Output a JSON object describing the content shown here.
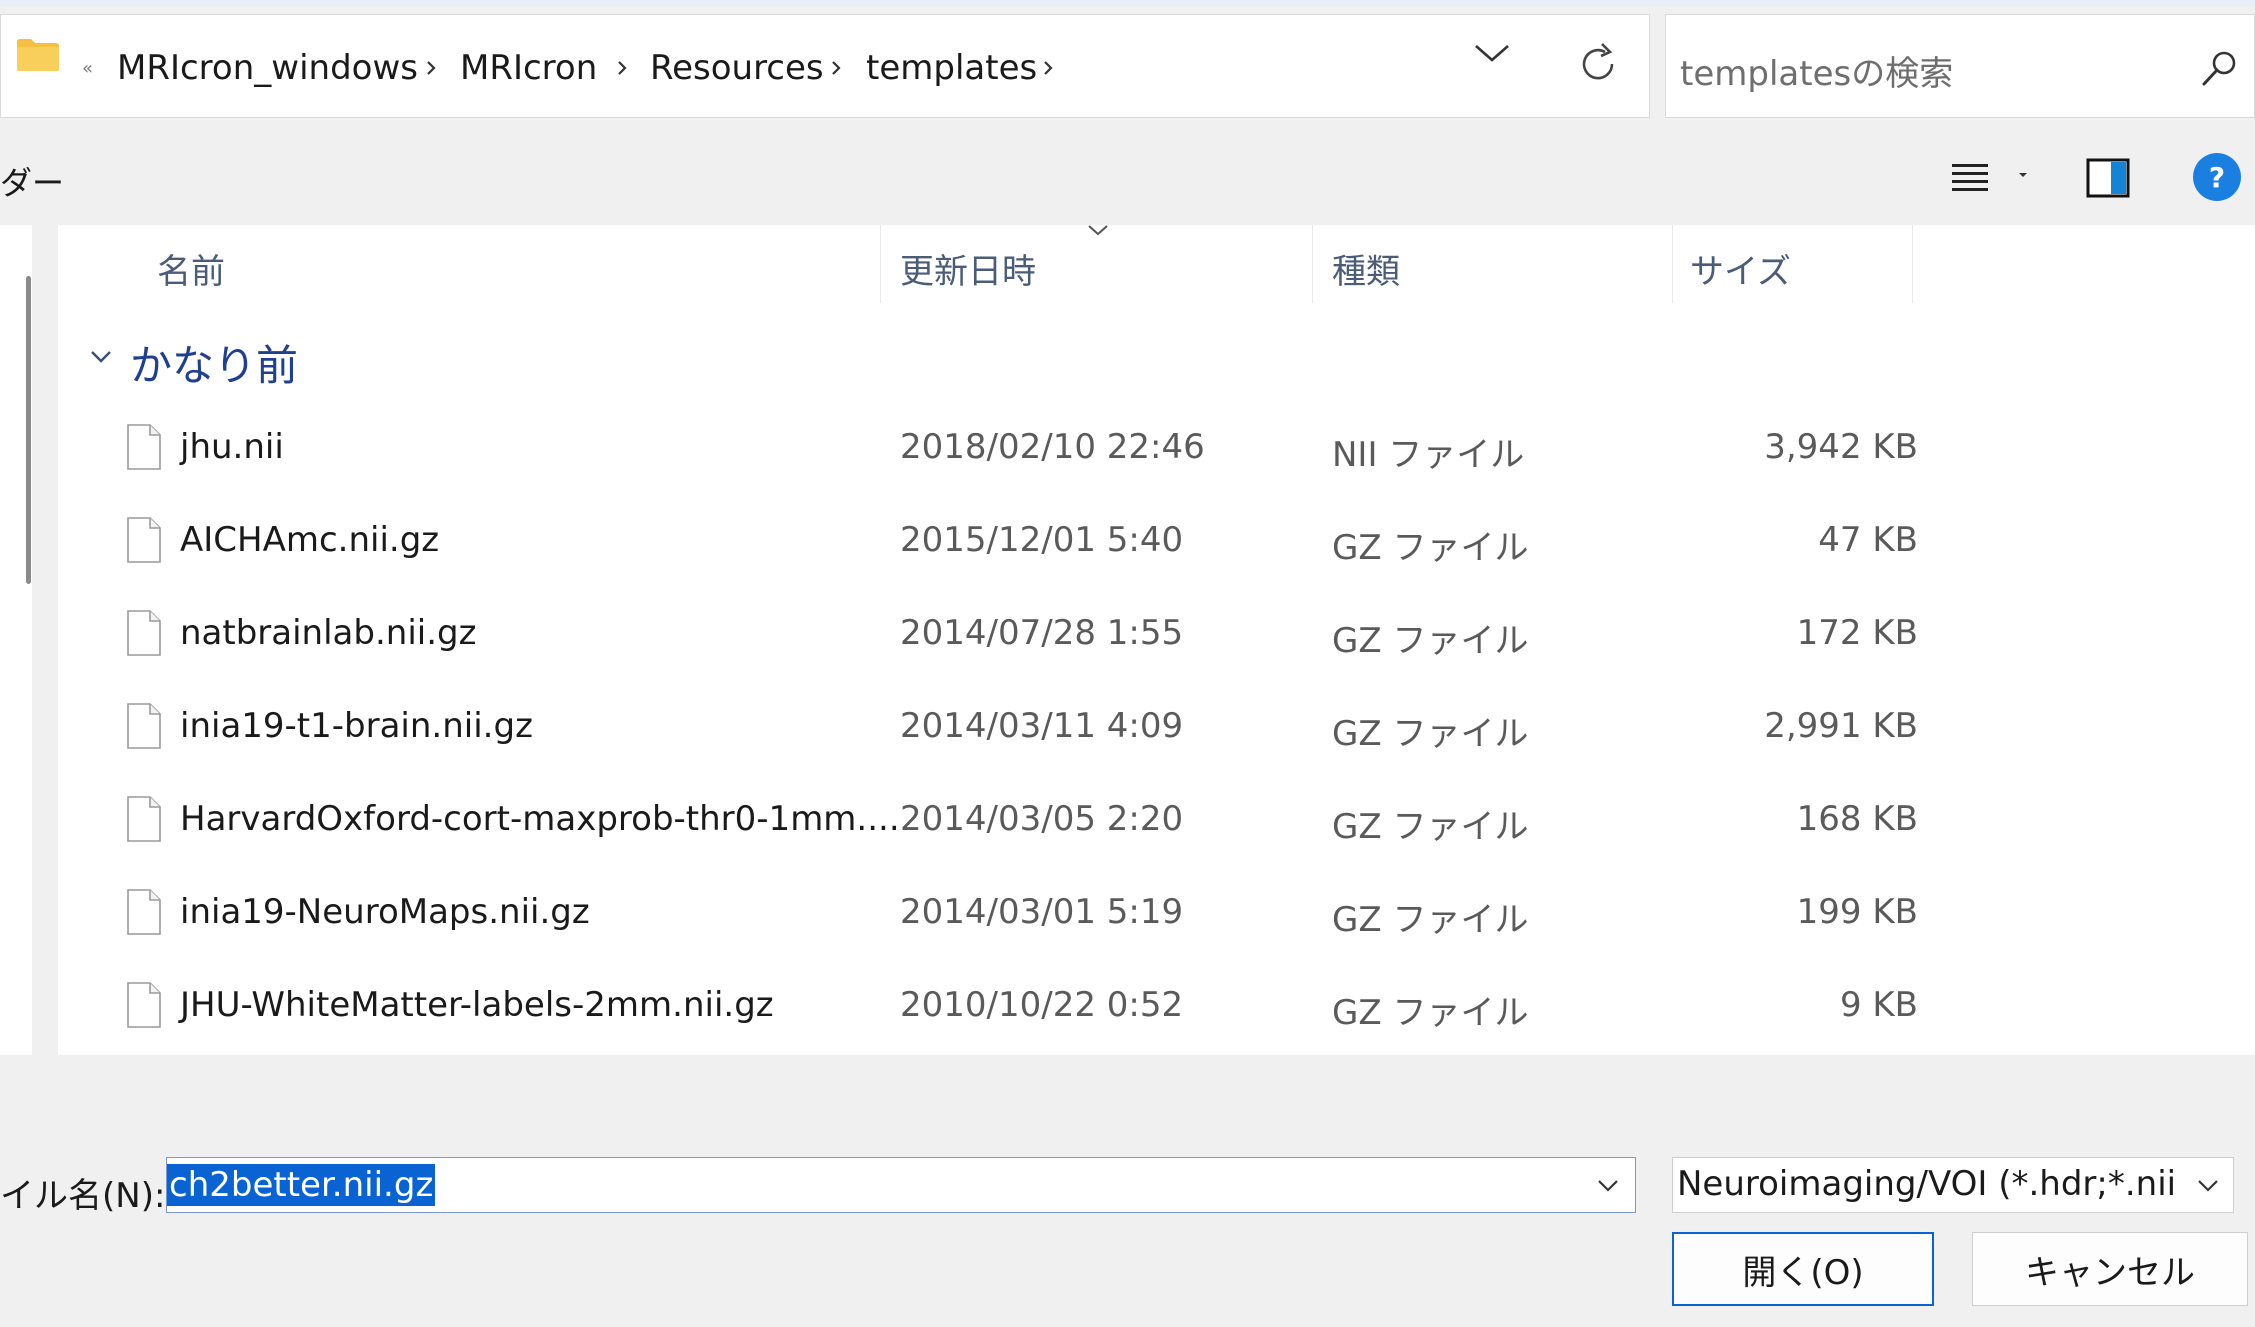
{
  "address_bar": {
    "overflow_glyph": "«",
    "breadcrumbs": [
      {
        "label": "MRIcron_windows"
      },
      {
        "label": "MRIcron"
      },
      {
        "label": "Resources"
      },
      {
        "label": "templates"
      }
    ]
  },
  "search": {
    "placeholder": "templatesの検索"
  },
  "toolbar": {
    "left_label": "ダー"
  },
  "columns": {
    "name": "名前",
    "date": "更新日時",
    "type": "種類",
    "size": "サイズ"
  },
  "group": {
    "label": "かなり前"
  },
  "files": [
    {
      "name": "jhu.nii",
      "date": "2018/02/10 22:46",
      "type": "NII ファイル",
      "size": "3,942 KB"
    },
    {
      "name": "AICHAmc.nii.gz",
      "date": "2015/12/01 5:40",
      "type": "GZ ファイル",
      "size": "47 KB"
    },
    {
      "name": "natbrainlab.nii.gz",
      "date": "2014/07/28 1:55",
      "type": "GZ ファイル",
      "size": "172 KB"
    },
    {
      "name": "inia19-t1-brain.nii.gz",
      "date": "2014/03/11 4:09",
      "type": "GZ ファイル",
      "size": "2,991 KB"
    },
    {
      "name": "HarvardOxford-cort-maxprob-thr0-1mm....",
      "date": "2014/03/05 2:20",
      "type": "GZ ファイル",
      "size": "168 KB"
    },
    {
      "name": "inia19-NeuroMaps.nii.gz",
      "date": "2014/03/01 5:19",
      "type": "GZ ファイル",
      "size": "199 KB"
    },
    {
      "name": "JHU-WhiteMatter-labels-2mm.nii.gz",
      "date": "2010/10/22 0:52",
      "type": "GZ ファイル",
      "size": "9 KB"
    }
  ],
  "bottom": {
    "filename_label": "イル名(N):",
    "filename_value": "ch2better.nii.gz",
    "filetype_value": "Neuroimaging/VOI (*.hdr;*.nii;*.n",
    "open_label": "開く(O)",
    "cancel_label": "キャンセル"
  },
  "colors": {
    "accent": "#0a63d2",
    "group_label": "#1f3f8f",
    "column_header": "#4a5c78",
    "folder": "#f4c042"
  },
  "icons": [
    "folder-icon",
    "chevron-right-icon",
    "chevron-down-icon",
    "refresh-icon",
    "search-icon",
    "view-menu-icon",
    "preview-pane-icon",
    "help-icon",
    "file-icon"
  ]
}
